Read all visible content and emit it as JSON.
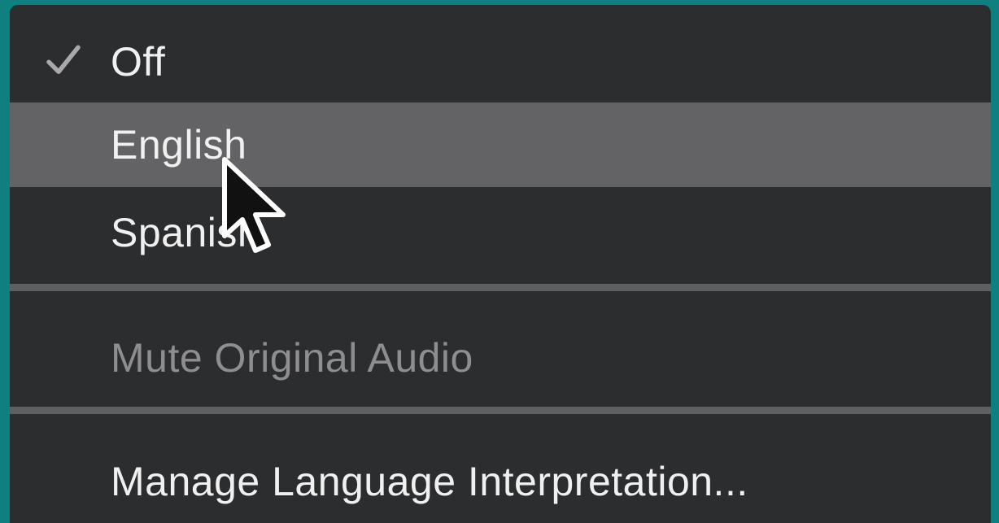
{
  "menu": {
    "items": [
      {
        "label": "Off",
        "checked": true
      },
      {
        "label": "English",
        "highlighted": true
      },
      {
        "label": "Spanish"
      }
    ],
    "mute_original_audio": {
      "label": "Mute Original Audio",
      "enabled": false
    },
    "manage": {
      "label": "Manage Language Interpretation..."
    }
  },
  "icons": {
    "check": "check-icon",
    "cursor": "mouse-pointer-icon"
  },
  "colors": {
    "background": "#0f7f7f",
    "menu_bg": "#2c2d2f",
    "highlight": "#636365",
    "separator": "#5f6062",
    "text": "#f0f0f0",
    "text_disabled": "#8e8e90"
  }
}
